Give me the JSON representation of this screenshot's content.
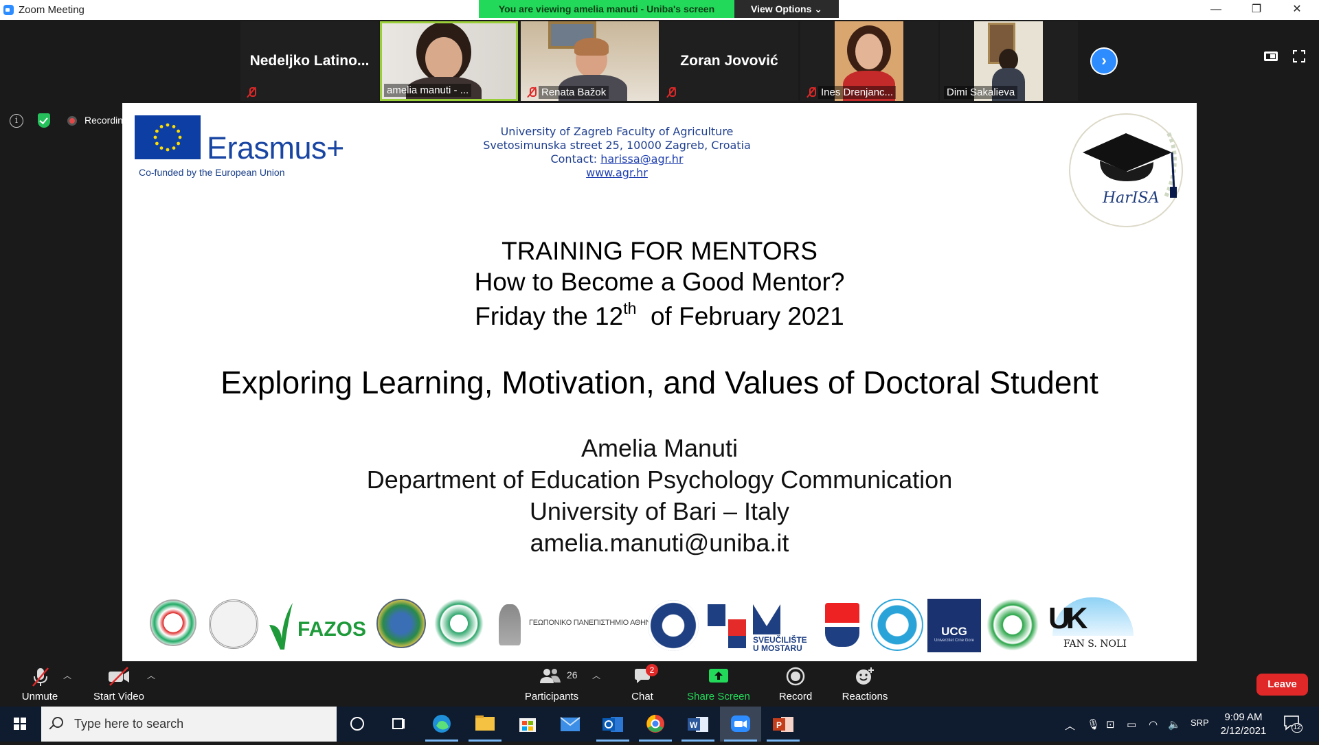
{
  "window": {
    "title": "Zoom Meeting",
    "banner": "You are viewing amelia manuti - Uniba's screen",
    "view_options": "View Options",
    "minimize": "—",
    "restore": "❐",
    "close": "✕"
  },
  "participants": [
    {
      "display": "Nedeljko  Latino...",
      "muted": true,
      "video": false
    },
    {
      "label": "amelia manuti - ...",
      "muted": false,
      "video": true,
      "active": true
    },
    {
      "label": "Renata Bažok",
      "muted": true,
      "video": true
    },
    {
      "display": "Zoran Jovović",
      "muted": true,
      "video": false
    },
    {
      "label": "Ines Drenjanc...",
      "muted": true,
      "video": true
    },
    {
      "label": "Dimi Sakalieva",
      "muted": false,
      "video": true
    }
  ],
  "status": {
    "recording_label": "Recordin"
  },
  "slide": {
    "logo_text": "Erasmus+",
    "cofunded": "Co-funded by the European Union",
    "contact": {
      "line1": "University of Zagreb Faculty of Agriculture",
      "line2": "Svetosimunska street 25, 10000 Zagreb, Croatia",
      "line3_prefix": "Contact: ",
      "email": "harissa@agr.hr",
      "website": "www.agr.hr"
    },
    "harisa_text": "HarISA",
    "heading1": "TRAINING FOR MENTORS",
    "heading2": "How to Become a Good Mentor?",
    "heading3_a": "Friday the 12",
    "heading3_sup": "th",
    "heading3_b": "  of February 2021",
    "main_title": "Exploring Learning, Motivation, and Values of Doctoral Student",
    "author": "Amelia Manuti",
    "department": "Department of Education Psychology Communication",
    "university": "University of Bari – Italy",
    "email": "amelia.manuti@uniba.it",
    "partner_logos": {
      "fazos": "FAZOS",
      "athens": "ΓΕΩΠΟΝΙΚΟ ΠΑΝΕΠΙΣΤΗΜΙΟ ΑΘΗΝΩΝ",
      "mostar": "SVEUČILIŠTE U MOSTARU",
      "ucg": "UCG",
      "ucg_sub": "Univerzitet Crne Gore",
      "fan_noli": "FAN S. NOLI",
      "uk": "UK"
    }
  },
  "toolbar": {
    "unmute": "Unmute",
    "start_video": "Start Video",
    "participants": "Participants",
    "participants_count": "26",
    "chat": "Chat",
    "chat_badge": "2",
    "share_screen": "Share Screen",
    "record": "Record",
    "reactions": "Reactions",
    "leave": "Leave"
  },
  "taskbar": {
    "search_placeholder": "Type here to search",
    "lang": "SRP",
    "time": "9:09 AM",
    "date": "2/12/2021",
    "notification_count": "12"
  }
}
